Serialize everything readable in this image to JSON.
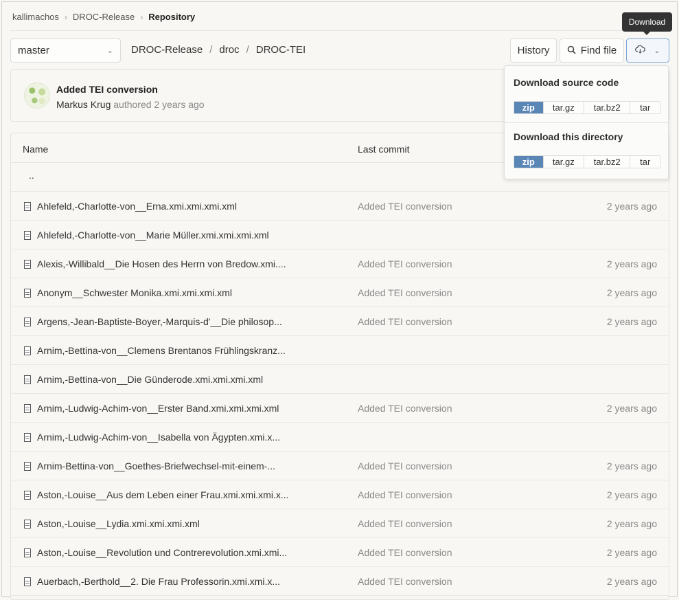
{
  "breadcrumb": [
    "kallimachos",
    "DROC-Release",
    "Repository"
  ],
  "branch": "master",
  "path": [
    "DROC-Release",
    "droc",
    "DROC-TEI"
  ],
  "buttons": {
    "history": "History",
    "find_file": "Find file"
  },
  "tooltip": "Download",
  "commit": {
    "title": "Added TEI conversion",
    "author": "Markus Krug",
    "action": "authored",
    "time": "2 years ago"
  },
  "table": {
    "headers": {
      "name": "Name",
      "last_commit": "Last commit"
    },
    "parent": "..",
    "rows": [
      {
        "name": "Ahlefeld,-Charlotte-von__Erna.xmi.xmi.xmi.xml",
        "commit": "Added TEI conversion",
        "age": "2 years ago"
      },
      {
        "name": "Ahlefeld,-Charlotte-von__Marie Müller.xmi.xmi.xmi.xml",
        "commit": "",
        "age": ""
      },
      {
        "name": "Alexis,-Willibald__Die Hosen des Herrn von Bredow.xmi....",
        "commit": "Added TEI conversion",
        "age": "2 years ago"
      },
      {
        "name": "Anonym__Schwester Monika.xmi.xmi.xmi.xml",
        "commit": "Added TEI conversion",
        "age": "2 years ago"
      },
      {
        "name": "Argens,-Jean-Baptiste-Boyer,-Marquis-d'__Die philosop...",
        "commit": "Added TEI conversion",
        "age": "2 years ago"
      },
      {
        "name": "Arnim,-Bettina-von__Clemens Brentanos Frühlingskranz...",
        "commit": "",
        "age": ""
      },
      {
        "name": "Arnim,-Bettina-von__Die Günderode.xmi.xmi.xmi.xml",
        "commit": "",
        "age": ""
      },
      {
        "name": "Arnim,-Ludwig-Achim-von__Erster Band.xmi.xmi.xmi.xml",
        "commit": "Added TEI conversion",
        "age": "2 years ago"
      },
      {
        "name": "Arnim,-Ludwig-Achim-von__Isabella von Ägypten.xmi.x...",
        "commit": "",
        "age": ""
      },
      {
        "name": "Arnim-Bettina-von__Goethes-Briefwechsel-mit-einem-...",
        "commit": "Added TEI conversion",
        "age": "2 years ago"
      },
      {
        "name": "Aston,-Louise__Aus dem Leben einer Frau.xmi.xmi.xmi.x...",
        "commit": "Added TEI conversion",
        "age": "2 years ago"
      },
      {
        "name": "Aston,-Louise__Lydia.xmi.xmi.xmi.xml",
        "commit": "Added TEI conversion",
        "age": "2 years ago"
      },
      {
        "name": "Aston,-Louise__Revolution und Contrerevolution.xmi.xmi...",
        "commit": "Added TEI conversion",
        "age": "2 years ago"
      },
      {
        "name": "Auerbach,-Berthold__2. Die Frau Professorin.xmi.xmi.x...",
        "commit": "Added TEI conversion",
        "age": "2 years ago"
      }
    ]
  },
  "download": {
    "source_title": "Download source code",
    "dir_title": "Download this directory",
    "formats": [
      "zip",
      "tar.gz",
      "tar.bz2",
      "tar"
    ],
    "selected": "zip"
  },
  "colors": {
    "accent": "#5a86b6",
    "tooltip_bg": "#333333"
  }
}
